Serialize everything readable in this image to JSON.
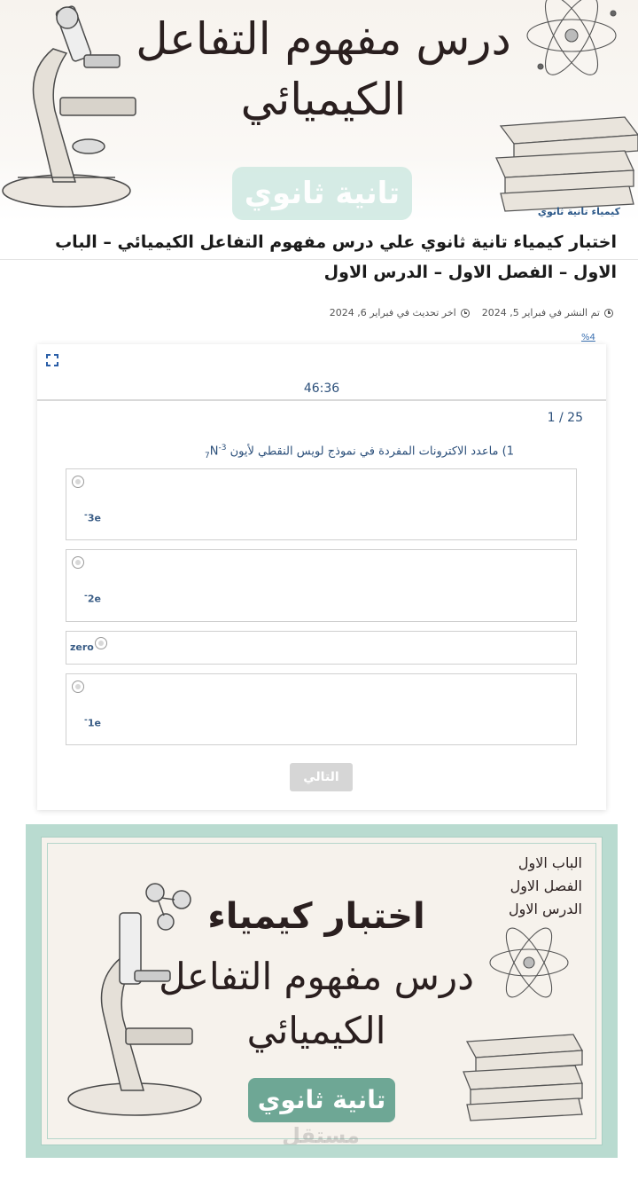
{
  "banner": {
    "title_line1": "درس مفهوم التفاعل",
    "title_line2": "الكيميائي",
    "badge": "تانية ثانوي",
    "tag": "كيمياء تانية ثانوي"
  },
  "article": {
    "title": "اختبار كيمياء تانية ثانوي علي درس مفهوم التفاعل الكيميائي – الباب الاول – الفصل الاول – الدرس الاول",
    "published": "تم النشر في فبراير 5, 2024",
    "updated": "اخر تحديث في فبراير 6, 2024"
  },
  "quiz": {
    "progress": "%4",
    "timer": "46:36",
    "question_count": "1 / 25",
    "question_text": "1) ماعدد الاكترونات المفردة في نموذج لويس النقطي لأيون",
    "formula_sub": "7",
    "formula_el": "N",
    "formula_sup": "-3",
    "options": [
      {
        "label": "3e",
        "mark": "-"
      },
      {
        "label": "2e",
        "mark": "-"
      },
      {
        "label": "zero",
        "mark": ""
      },
      {
        "label": "1e",
        "mark": "-"
      }
    ],
    "next_label": "التالي"
  },
  "poster": {
    "lessons": [
      "الباب الاول",
      "الفصل الاول",
      "الدرس الاول"
    ],
    "title1": "اختبار كيمياء",
    "title2": "درس مفهوم التفاعل",
    "title3": "الكيميائي",
    "badge": "تانية ثانوي",
    "watermark": "مستقل"
  },
  "colors": {
    "accent": "#2b4f7a",
    "banner_badge": "#d3ebe4",
    "poster_bg": "#b9dbd0",
    "poster_badge": "#6ea795"
  }
}
